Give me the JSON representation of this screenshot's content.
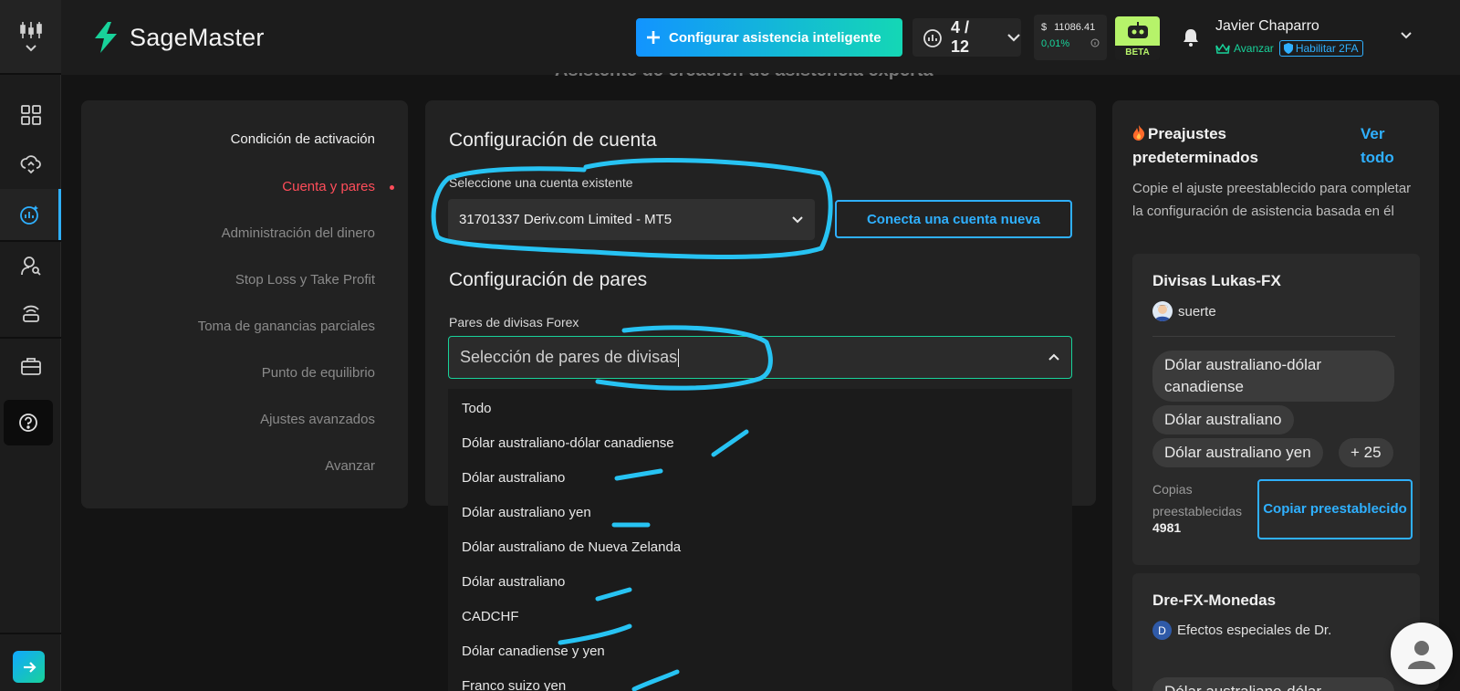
{
  "brand": {
    "name": "SageMaster"
  },
  "topbar": {
    "cta_label": "Configurar asistencia inteligente",
    "counter": "4 / 12",
    "balance_currency": "$",
    "balance_amount": "11086.41",
    "balance_change": "0,01%",
    "beta_label": "BETA",
    "user_name": "Javier Chaparro",
    "user_level": "Avanzar",
    "user_2fa": "Habilitar 2FA"
  },
  "page": {
    "ghost_title": "Asistente de creación de asistencia experta"
  },
  "steps": [
    {
      "label": "Condición de activación",
      "state": "done"
    },
    {
      "label": "Cuenta y pares",
      "state": "current"
    },
    {
      "label": "Administración del dinero",
      "state": "pending"
    },
    {
      "label": "Stop Loss y Take Profit",
      "state": "pending"
    },
    {
      "label": "Toma de ganancias parciales",
      "state": "pending"
    },
    {
      "label": "Punto de equilibrio",
      "state": "pending"
    },
    {
      "label": "Ajustes avanzados",
      "state": "pending"
    },
    {
      "label": "Avanzar",
      "state": "pending"
    }
  ],
  "account": {
    "heading": "Configuración de cuenta",
    "select_label": "Seleccione una cuenta existente",
    "selected_value": "31701337 Deriv.com Limited - MT5",
    "connect_label": "Conecta una cuenta nueva"
  },
  "pairs": {
    "heading": "Configuración de pares",
    "field_label": "Pares de divisas Forex",
    "input_value": "Selección de pares de divisas",
    "options": [
      "Todo",
      "Dólar australiano-dólar canadiense",
      "Dólar australiano",
      "Dólar australiano yen",
      "Dólar australiano de Nueva Zelanda",
      "Dólar australiano",
      "CADCHF",
      "Dólar canadiense y yen",
      "Franco suizo yen"
    ]
  },
  "presets": {
    "title": "Preajustes predeterminados",
    "view_all": "Ver todo",
    "description": "Copie el ajuste preestablecido para completar la configuración de asistencia basada en él",
    "cards": [
      {
        "title": "Divisas Lukas-FX",
        "author": "suerte",
        "tags": [
          "Dólar australiano-dólar canadiense",
          "Dólar australiano",
          "Dólar australiano yen",
          "+ 25"
        ],
        "copies_label": "Copias preestablecidas",
        "copies": "4981",
        "copy_label": "Copiar preestablecido"
      },
      {
        "title": "Dre-FX-Monedas",
        "author_initial": "D",
        "author": "Efectos especiales de Dr.",
        "tags": [
          "Dólar australiano-dólar"
        ]
      }
    ]
  },
  "colors": {
    "accent_blue": "#2fb0ff",
    "accent_green": "#18d29a",
    "error_red": "#ff4d5a",
    "annotation": "#27c3f3"
  },
  "icons": [
    "candles-icon",
    "dashboard-icon",
    "cloud-sync-icon",
    "assistant-icon",
    "users-icon",
    "signal-icon",
    "briefcase-icon",
    "help-icon",
    "arrow-right-icon",
    "plus-icon",
    "bell-icon",
    "crown-icon",
    "shield-icon",
    "chevron-down-icon",
    "chevron-up-icon",
    "fire-icon",
    "user-avatar-icon"
  ]
}
